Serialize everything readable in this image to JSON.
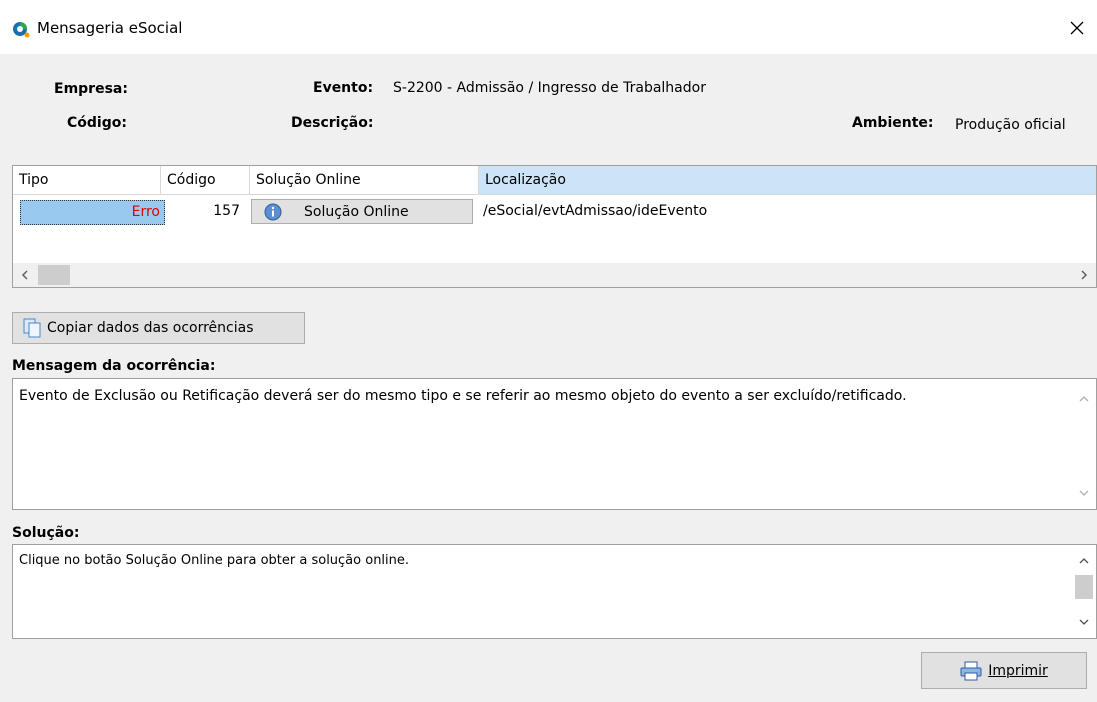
{
  "window": {
    "title": "Mensageria eSocial"
  },
  "info": {
    "empresa_label": "Empresa:",
    "codigo_label": "Código:",
    "evento_label": "Evento:",
    "evento_value": "S-2200 - Admissão / Ingresso de Trabalhador",
    "descricao_label": "Descrição:",
    "ambiente_label": "Ambiente:",
    "ambiente_value": "Produção oficial"
  },
  "grid": {
    "columns": [
      "Tipo",
      "Código",
      "Solução Online",
      "Localização"
    ],
    "rows": [
      {
        "tipo": "Erro",
        "codigo": "157",
        "solucao": "Solução Online",
        "localizacao": "/eSocial/evtAdmissao/ideEvento"
      }
    ]
  },
  "actions": {
    "copy_label": "Copiar dados das ocorrências",
    "print_label": "Imprimir"
  },
  "mensagem": {
    "label": "Mensagem da ocorrência:",
    "text": "Evento de Exclusão ou Retificação deverá ser do mesmo tipo e se referir ao mesmo objeto do evento a ser excluído/retificado."
  },
  "solucao": {
    "label": "Solução:",
    "text": "Clique no botão Solução Online para obter a solução online."
  },
  "colors": {
    "error_text": "#e00000",
    "selected_cell": "#99c9ef",
    "header_selected": "#cce4f7"
  }
}
